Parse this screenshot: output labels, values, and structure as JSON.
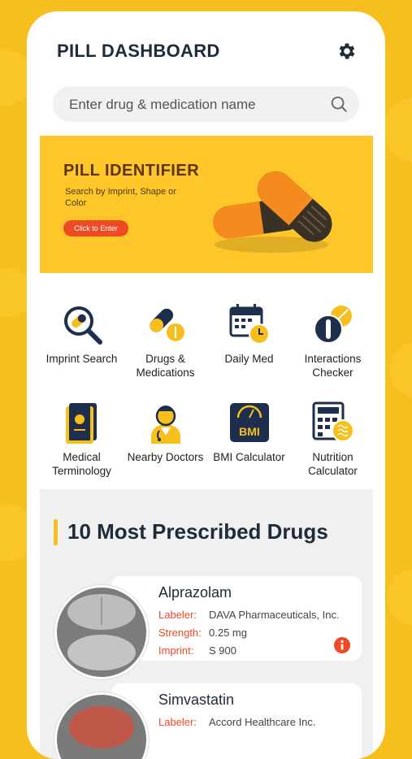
{
  "header": {
    "title": "PILL DASHBOARD"
  },
  "search": {
    "placeholder": "Enter drug & medication name"
  },
  "banner": {
    "title": "PILL IDENTIFIER",
    "subtitle": "Search by Imprint, Shape or Color",
    "button_label": "Click to Enter"
  },
  "features": [
    {
      "label": "Imprint Search",
      "icon": "magnifier-pill-icon"
    },
    {
      "label": "Drugs & Medications",
      "icon": "pills-icon"
    },
    {
      "label": "Daily Med",
      "icon": "calendar-clock-icon"
    },
    {
      "label": "Interactions Checker",
      "icon": "interactions-icon"
    },
    {
      "label": "Medical Terminology",
      "icon": "book-icon"
    },
    {
      "label": "Nearby Doctors",
      "icon": "doctor-icon"
    },
    {
      "label": "BMI Calculator",
      "icon": "bmi-scale-icon"
    },
    {
      "label": "Nutrition Calculator",
      "icon": "nutrition-calculator-icon"
    }
  ],
  "drugs_section": {
    "title": "10 Most Prescribed Drugs",
    "labels": {
      "labeler": "Labeler:",
      "strength": "Strength:",
      "imprint": "Imprint:"
    },
    "items": [
      {
        "name": "Alprazolam",
        "labeler": "DAVA Pharmaceuticals, Inc.",
        "strength": "0.25 mg",
        "imprint": "S 900"
      },
      {
        "name": "Simvastatin",
        "labeler": "Accord Healthcare Inc."
      }
    ]
  },
  "colors": {
    "background": "#F7BF1E",
    "accent": "#EE4A27",
    "title": "#1f2b3a",
    "navy": "#1e2f4d",
    "yellow": "#F7BF1E"
  }
}
